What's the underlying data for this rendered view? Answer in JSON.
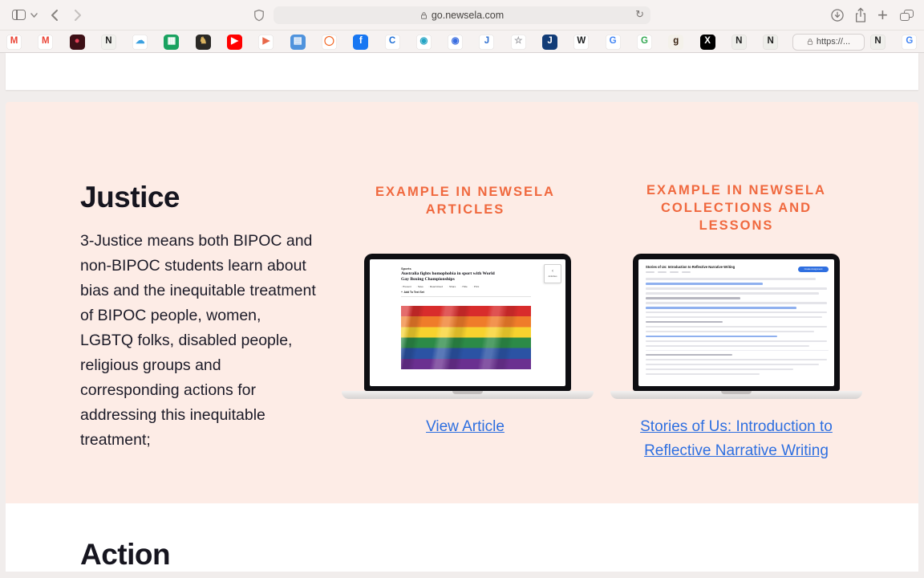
{
  "colors": {
    "accent_orange": "#f0693f",
    "link_blue": "#2e6fe0",
    "page_pink": "#fdece6",
    "heading_dark": "#16151f"
  },
  "browser": {
    "url": "go.newsela.com",
    "tab_label": "https://...",
    "bookmarks": [
      {
        "name": "gmail-icon",
        "glyph": "M",
        "bg": "#ffffff",
        "fg": "#ea4335",
        "brd": true
      },
      {
        "name": "gmail-icon-2",
        "glyph": "M",
        "bg": "#ffffff",
        "fg": "#ea4335",
        "brd": true
      },
      {
        "name": "record-icon",
        "glyph": "●",
        "bg": "#3d1016",
        "fg": "#e24158"
      },
      {
        "name": "notion-icon",
        "glyph": "N",
        "bg": "#f1f1ed",
        "fg": "#1f1f1f",
        "brd": true
      },
      {
        "name": "cloud-icon",
        "glyph": "☁",
        "bg": "#ffffff",
        "fg": "#3aa0e0",
        "brd": true
      },
      {
        "name": "sheets-icon",
        "glyph": "▦",
        "bg": "#1aa260",
        "fg": "#ffffff"
      },
      {
        "name": "chess-icon",
        "glyph": "♞",
        "bg": "#2b2926",
        "fg": "#d9b25f"
      },
      {
        "name": "youtube-icon",
        "glyph": "▶",
        "bg": "#ff0000",
        "fg": "#ffffff"
      },
      {
        "name": "play-icon",
        "glyph": "▶",
        "bg": "#ffffff",
        "fg": "#e8684a",
        "brd": true
      },
      {
        "name": "folder-icon",
        "glyph": "▤",
        "bg": "#4f93dd",
        "fg": "#ffffff"
      },
      {
        "name": "ring-icon",
        "glyph": "◯",
        "bg": "#ffffff",
        "fg": "#f26522",
        "brd": true
      },
      {
        "name": "facebook-icon",
        "glyph": "f",
        "bg": "#1877f2",
        "fg": "#ffffff"
      },
      {
        "name": "c-icon",
        "glyph": "C",
        "bg": "#ffffff",
        "fg": "#1f6fd6",
        "brd": true
      },
      {
        "name": "compass-icon",
        "glyph": "◉",
        "bg": "#ffffff",
        "fg": "#24a4c4",
        "brd": true
      },
      {
        "name": "circle-icon",
        "glyph": "◉",
        "bg": "#ffffff",
        "fg": "#3a6de0",
        "brd": true
      },
      {
        "name": "j-icon",
        "glyph": "J",
        "bg": "#ffffff",
        "fg": "#2f6fd0",
        "brd": true
      },
      {
        "name": "star-icon",
        "glyph": "☆",
        "bg": "#ffffff",
        "fg": "#98989d",
        "brd": true
      },
      {
        "name": "j-square-icon",
        "glyph": "J",
        "bg": "#123c77",
        "fg": "#ffffff"
      },
      {
        "name": "wikipedia-icon",
        "glyph": "W",
        "bg": "#ffffff",
        "fg": "#202122",
        "brd": true
      },
      {
        "name": "google-icon",
        "glyph": "G",
        "bg": "#ffffff",
        "fg": "#4285f4",
        "brd": true
      },
      {
        "name": "google-icon-2",
        "glyph": "G",
        "bg": "#ffffff",
        "fg": "#34a853",
        "brd": true
      },
      {
        "name": "goodreads-icon",
        "glyph": "g",
        "bg": "#f4f1ea",
        "fg": "#382110"
      },
      {
        "name": "x-icon",
        "glyph": "X",
        "bg": "#000000",
        "fg": "#ffffff"
      },
      {
        "name": "notion-icon-2",
        "glyph": "N",
        "bg": "#eeeeea",
        "fg": "#222222",
        "brd": true
      },
      {
        "name": "notion-icon-3",
        "glyph": "N",
        "bg": "#eeeeea",
        "fg": "#222222",
        "brd": true
      }
    ],
    "tab_strip_icons": [
      {
        "name": "notion-icon-4",
        "glyph": "N",
        "bg": "#efefeb",
        "fg": "#222222",
        "brd": true
      },
      {
        "name": "google-icon-3",
        "glyph": "G",
        "bg": "#ffffff",
        "fg": "#4285f4",
        "brd": true
      }
    ]
  },
  "page": {
    "justice": {
      "title": "Justice",
      "body": "3-Justice means both BIPOC and non-BIPOC students learn about bias and the inequitable treatment of BIPOC people, women, LGBTQ folks, disabled people, religious groups and corresponding actions for addressing this inequitable treatment;"
    },
    "articles": {
      "heading": "EXAMPLE IN NEWSELA ARTICLES",
      "link": "View Article",
      "mock": {
        "category": "Sports",
        "headline": "Australia fights homophobia in sport with World Gay Boxing Championships",
        "toolbar_items": [
          "Present",
          "Save",
          "Read Aloud",
          "Share",
          "Hide",
          "Print"
        ],
        "add_to_text_set": "Add To Text Set",
        "activities": "Activities"
      }
    },
    "collections": {
      "heading": "EXAMPLE IN NEWSELA COLLECTIONS AND LESSONS",
      "link": "Stories of Us: Introduction to Reflective Narrative Writing",
      "mock": {
        "title": "Stories of Us: Introduction to Reflective Narrative Writing",
        "assign_button": "Create Assignment"
      }
    },
    "action": {
      "title": "Action"
    }
  }
}
